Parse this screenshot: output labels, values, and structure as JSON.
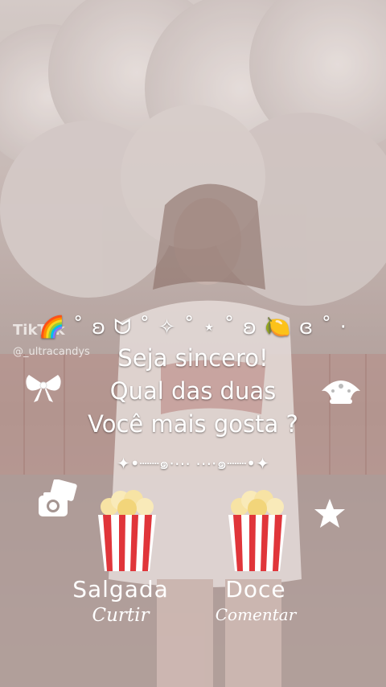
{
  "watermark": {
    "platform": "TikTok",
    "handle": "@_ultracandys"
  },
  "overlay": {
    "emoji_line": "🌈 ˚ ʚ ᗢ ˚ ✧ ˚ ⋆ ˚ ʚ 🍋 ɞ ˚ ·",
    "lines": [
      "Seja sincero!",
      "Qual das duas",
      "Você mais gosta ?"
    ],
    "divider": "✦•┈┈๑⋅⋯ ⋯⋅๑┈┈•✦"
  },
  "options": [
    {
      "title": "Salgada",
      "action": "Curtir",
      "icon": "popcorn-icon"
    },
    {
      "title": "Doce",
      "action": "Comentar",
      "icon": "popcorn-icon"
    }
  ],
  "decor": {
    "left_top": "bow-icon",
    "right_top": "crown-icon",
    "left_bottom": "camera-icon",
    "right_bottom": "star-icon"
  },
  "colors": {
    "text": "#ffffff",
    "bg_tint": "#b7a7a3"
  }
}
